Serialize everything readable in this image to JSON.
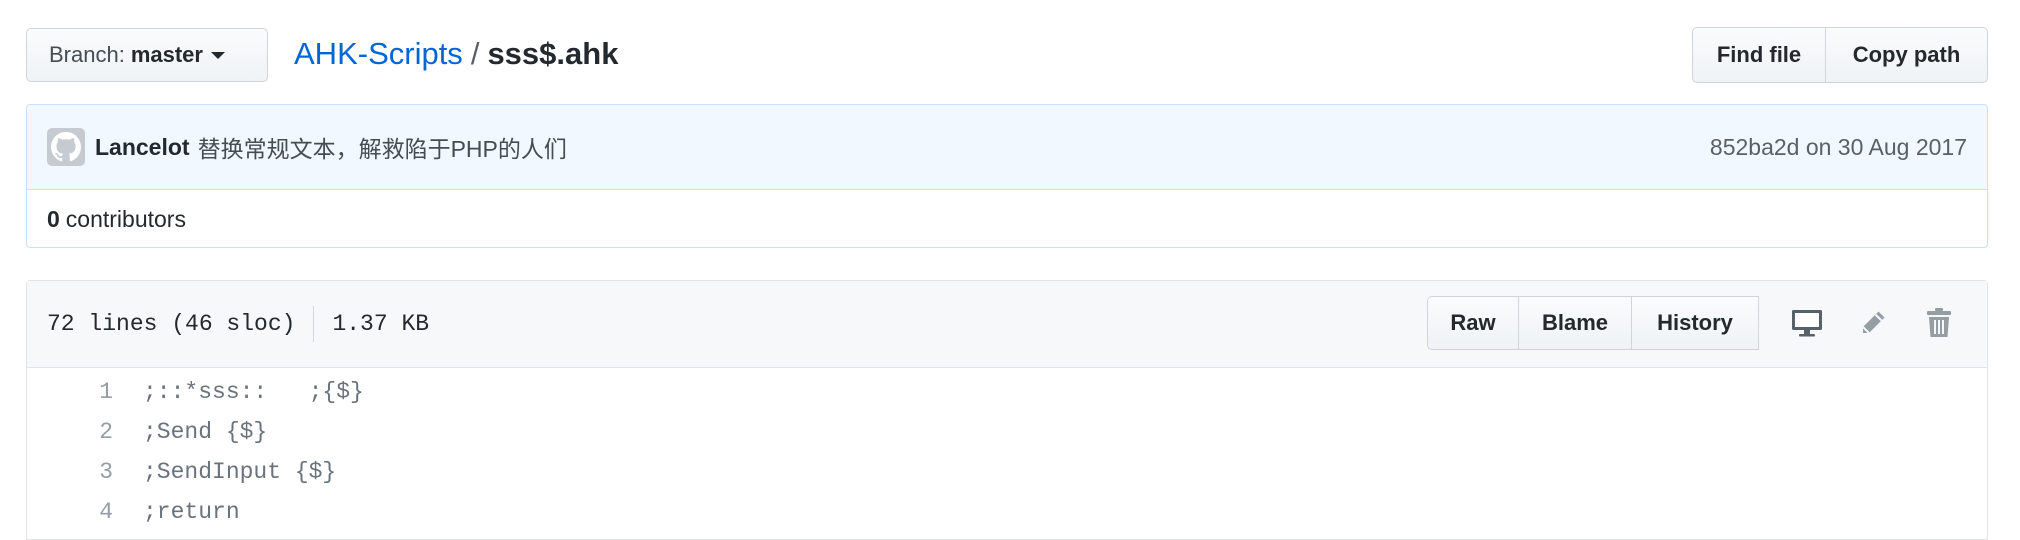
{
  "branch": {
    "label": "Branch:",
    "name": "master"
  },
  "breadcrumb": {
    "repo": "AHK-Scripts",
    "separator": "/",
    "file": "sss$.ahk"
  },
  "toolbar": {
    "find_file": "Find file",
    "copy_path": "Copy path"
  },
  "commit": {
    "author": "Lancelot",
    "message": "替换常规文本，解救陷于PHP的人们",
    "meta": "852ba2d on 30 Aug 2017"
  },
  "contributors": {
    "count": "0",
    "label": "contributors"
  },
  "file": {
    "lines_info": "72 lines (46 sloc)",
    "size": "1.37 KB",
    "actions": {
      "raw": "Raw",
      "blame": "Blame",
      "history": "History"
    },
    "icons": [
      "desktop-icon",
      "pencil-icon",
      "trash-icon"
    ]
  },
  "code_lines": [
    {
      "num": "1",
      "text": ";::*sss::   ;{$}"
    },
    {
      "num": "2",
      "text": ";Send {$}"
    },
    {
      "num": "3",
      "text": ";SendInput {$}"
    },
    {
      "num": "4",
      "text": ";return"
    }
  ]
}
